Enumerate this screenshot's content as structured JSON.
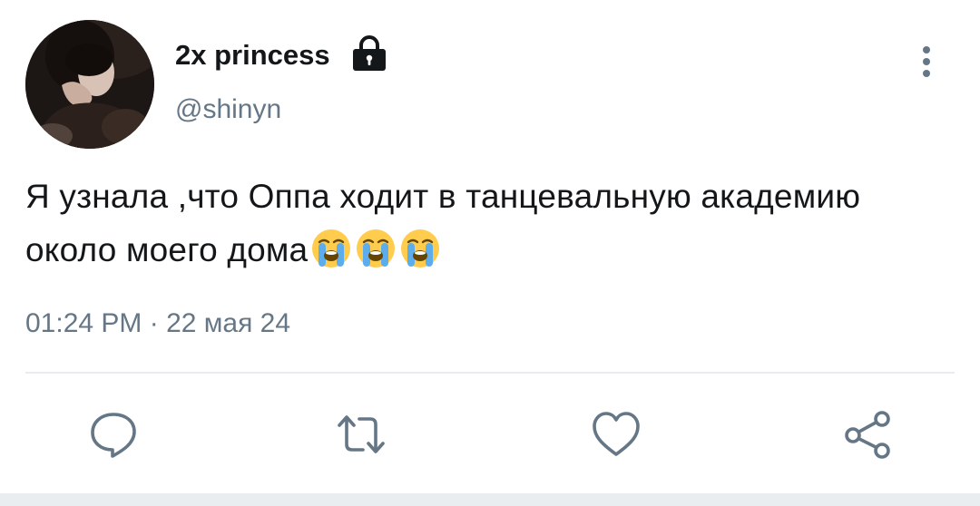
{
  "tweet": {
    "author": {
      "display_name": "2x princess",
      "handle": "@shinyn",
      "protected_icon": "lock-icon",
      "avatar": "avatar"
    },
    "text": "Я узнала ,что Оппа ходит в танцевальную академию около моего дома",
    "emojis": [
      "😭",
      "😭",
      "😭"
    ],
    "timestamp": "01:24 PM · 22 мая 24",
    "menu_icon": "more-vertical-icon"
  },
  "actions": [
    {
      "name": "reply",
      "icon": "comment-icon"
    },
    {
      "name": "retweet",
      "icon": "retweet-icon"
    },
    {
      "name": "like",
      "icon": "heart-icon"
    },
    {
      "name": "share",
      "icon": "share-icon"
    }
  ],
  "colors": {
    "text_primary": "#14171a",
    "text_secondary": "#657786",
    "icon": "#657786",
    "divider": "#e6ecf0",
    "background": "#ffffff"
  }
}
